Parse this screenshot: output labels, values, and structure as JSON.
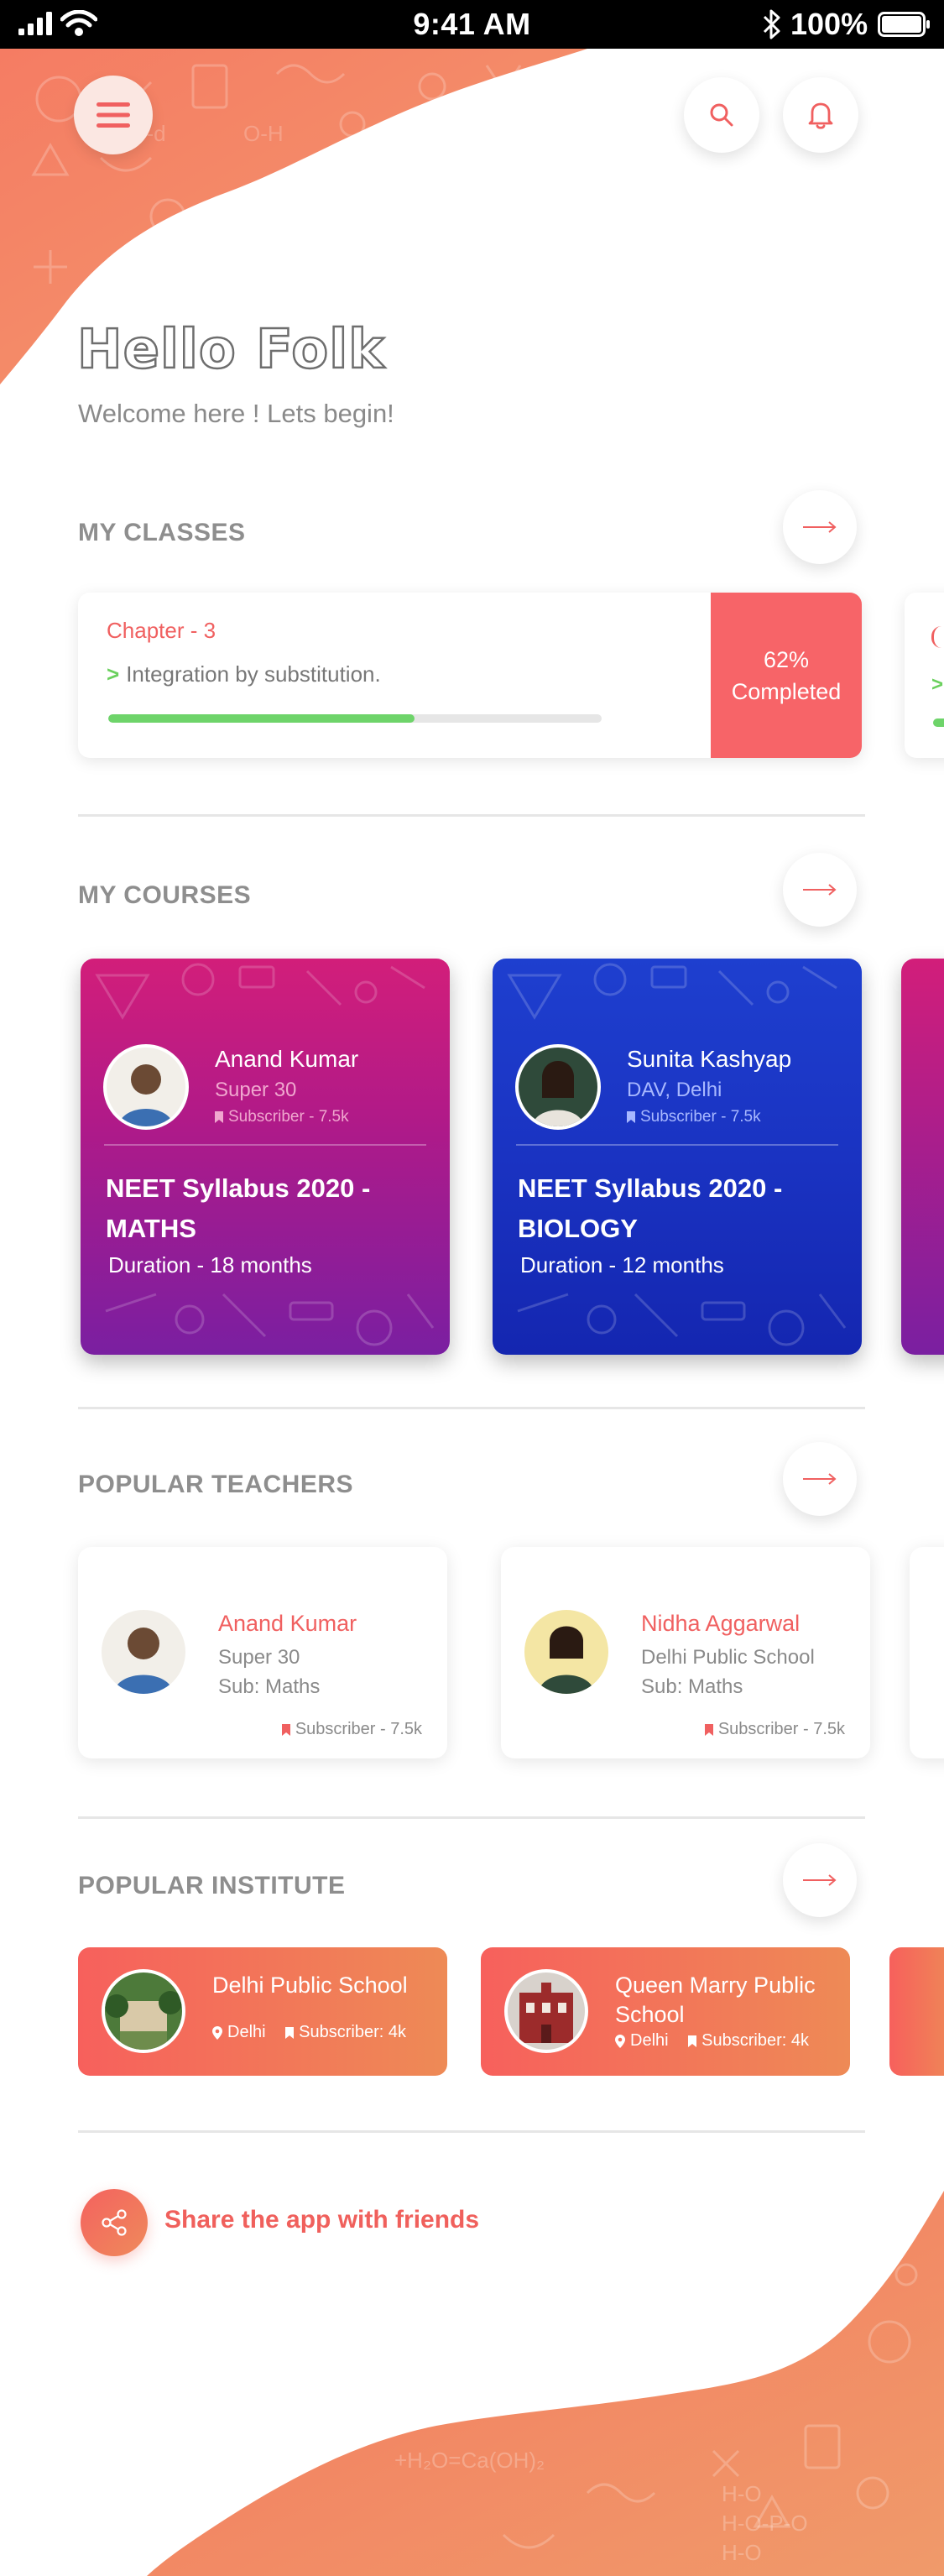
{
  "status_bar": {
    "time": "9:41 AM",
    "battery": "100%"
  },
  "header": {
    "greeting": "Hello Folk",
    "welcome": "Welcome here ! Lets begin!"
  },
  "sections": {
    "my_classes": "MY CLASSES",
    "my_courses": "MY COURSES",
    "popular_teachers": "POPULAR TEACHERS",
    "popular_institute": "POPULAR INSTITUTE"
  },
  "classes": [
    {
      "chapter": "Chapter - 3",
      "topic": "Integration by substitution.",
      "progress_percent": 62,
      "completed_percent": "62%",
      "completed_label": "Completed"
    }
  ],
  "courses": [
    {
      "teacher": "Anand Kumar",
      "org": "Super 30",
      "subscribers": "Subscriber - 7.5k",
      "title": "NEET Syllabus 2020 - MATHS",
      "duration": "Duration - 18 months",
      "color": "#c01d82"
    },
    {
      "teacher": "Sunita Kashyap",
      "org": "DAV, Delhi",
      "subscribers": "Subscriber - 7.5k",
      "title": "NEET Syllabus 2020 - BIOLOGY",
      "duration": "Duration - 12 months",
      "color": "#1a33c2"
    }
  ],
  "teachers": [
    {
      "name": "Anand Kumar",
      "org": "Super 30",
      "subject": "Sub: Maths",
      "subscribers": "Subscriber - 7.5k"
    },
    {
      "name": "Nidha Aggarwal",
      "org": "Delhi Public School",
      "subject": "Sub: Maths",
      "subscribers": "Subscriber - 7.5k"
    }
  ],
  "institutes": [
    {
      "name": "Delhi Public School",
      "location": "Delhi",
      "subscribers": "Subscriber: 4k"
    },
    {
      "name": "Queen Marry Public School",
      "location": "Delhi",
      "subscribers": "Subscriber: 4k"
    }
  ],
  "share": {
    "label": "Share the app with friends"
  },
  "colors": {
    "accent": "#f4625f",
    "accent_orange": "#ef8a56",
    "progress": "#6ed46a"
  },
  "icons": [
    "menu-icon",
    "search-icon",
    "bell-icon",
    "arrow-right-icon",
    "bookmark-icon",
    "location-pin-icon",
    "share-icon",
    "chevron-right-icon"
  ]
}
